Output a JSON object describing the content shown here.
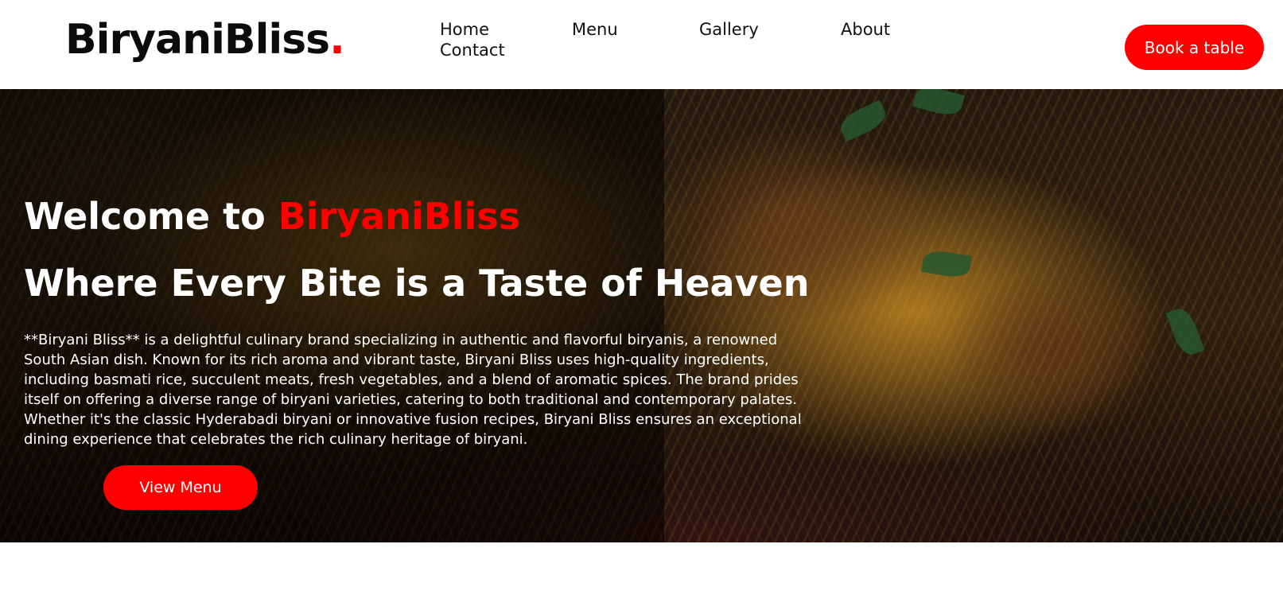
{
  "header": {
    "logo_text": "BiryaniBliss",
    "logo_dot": ".",
    "nav": [
      "Home",
      "Menu",
      "Gallery",
      "About",
      "Contact"
    ],
    "cta_label": "Book a table"
  },
  "hero": {
    "welcome_prefix": "Welcome to ",
    "welcome_brand": "BiryaniBliss",
    "tagline": "Where Every Bite is a Taste of Heaven",
    "description": "**Biryani Bliss** is a delightful culinary brand specializing in authentic and flavorful biryanis, a renowned South Asian dish. Known for its rich aroma and vibrant taste, Biryani Bliss uses high-quality ingredients, including basmati rice, succulent meats, fresh vegetables, and a blend of aromatic spices. The brand prides itself on offering a diverse range of biryani varieties, catering to both traditional and contemporary palates. Whether it's the classic Hyderabadi biryani or innovative fusion recipes, Biryani Bliss ensures an exceptional dining experience that celebrates the rich culinary heritage of biryani.",
    "cta_label": "View Menu"
  },
  "colors": {
    "accent": "#ff0000",
    "header_bg": "#ffffff",
    "hero_text": "#ffffff"
  }
}
